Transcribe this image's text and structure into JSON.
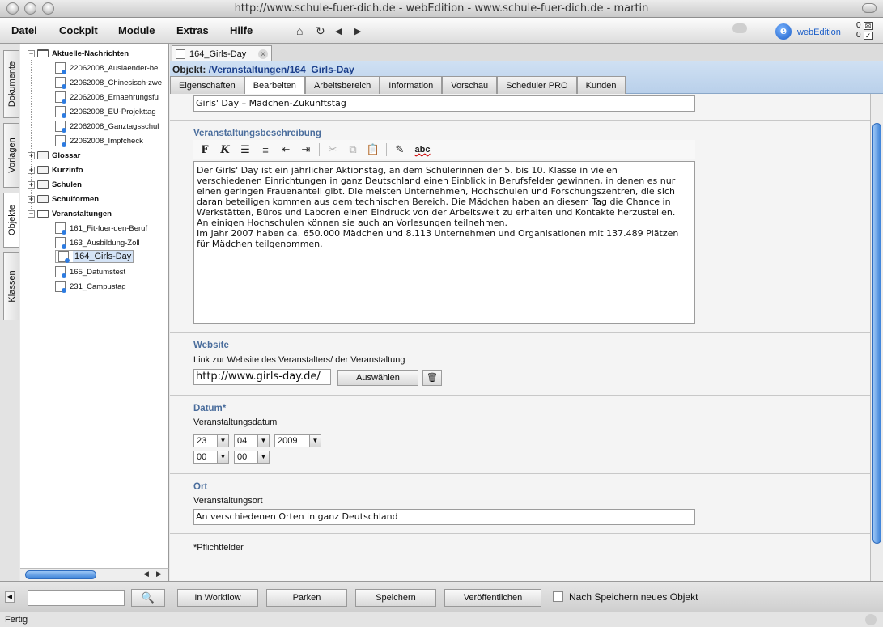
{
  "window": {
    "title": "http://www.schule-fuer-dich.de - webEdition - www.schule-fuer-dich.de - martin"
  },
  "menu": {
    "items": [
      "Datei",
      "Cockpit",
      "Module",
      "Extras",
      "Hilfe"
    ],
    "brand": "webEdition",
    "brand_letter": "e",
    "counter1": "0",
    "counter2": "0"
  },
  "side_tabs": [
    "Dokumente",
    "Vorlagen",
    "Objekte",
    "Klassen"
  ],
  "tree": {
    "aktuelle": {
      "label": "Aktuelle-Nachrichten",
      "children": [
        "22062008_Auslaender-be",
        "22062008_Chinesisch-zwe",
        "22062008_Ernaehrungsfu",
        "22062008_EU-Projekttag",
        "22062008_Ganztagsschul",
        "22062008_Impfcheck"
      ]
    },
    "folders": [
      "Glossar",
      "Kurzinfo",
      "Schulen",
      "Schulformen"
    ],
    "veranstaltungen": {
      "label": "Veranstaltungen",
      "children": [
        "161_Fit-fuer-den-Beruf",
        "163_Ausbildung-Zoll",
        "164_Girls-Day",
        "165_Datumstest",
        "231_Campustag"
      ]
    }
  },
  "doc_tab": {
    "label": "164_Girls-Day"
  },
  "object": {
    "prefix": "Objekt:",
    "path": "/Veranstaltungen/164_Girls-Day"
  },
  "tabs": [
    "Eigenschaften",
    "Bearbeiten",
    "Arbeitsbereich",
    "Information",
    "Vorschau",
    "Scheduler PRO",
    "Kunden"
  ],
  "form": {
    "name_value": "Girls' Day – Mädchen-Zukunftstag",
    "beschreibung_heading": "Veranstaltungsbeschreibung",
    "beschreibung_text": "Der Girls' Day ist ein jährlicher Aktionstag, an dem Schülerinnen der 5. bis 10. Klasse in vielen\nverschiedenen Einrichtungen in ganz Deutschland einen Einblick in Berufsfelder gewinnen, in denen es nur\neinen geringen Frauenanteil gibt. Die meisten Unternehmen, Hochschulen und Forschungszentren, die sich\ndaran beteiligen kommen aus dem technischen Bereich. Die Mädchen haben an diesem Tag die Chance in\nWerkstätten, Büros und Laboren einen Eindruck von der Arbeitswelt zu erhalten und Kontakte herzustellen.\nAn einigen Hochschulen können sie auch an Vorlesungen teilnehmen.\nIm Jahr 2007 haben ca. 650.000 Mädchen und 8.113 Unternehmen und Organisationen mit 137.489 Plätzen\nfür Mädchen teilgenommen.",
    "toolbar": {
      "bold": "F",
      "italic": "K",
      "spell": "abc"
    },
    "website_heading": "Website",
    "website_sub": "Link zur Website des Veranstalters/ der Veranstaltung",
    "website_value": "http://www.girls-day.de/",
    "website_button": "Auswählen",
    "datum_heading": "Datum*",
    "datum_sub": "Veranstaltungsdatum",
    "day": "23",
    "month": "04",
    "year": "2009",
    "hour": "00",
    "minute": "00",
    "ort_heading": "Ort",
    "ort_sub": "Veranstaltungsort",
    "ort_value": "An verschiedenen Orten in ganz Deutschland",
    "required_note": "*Pflichtfelder"
  },
  "bottom": {
    "buttons": [
      "In Workflow",
      "Parken",
      "Speichern",
      "Veröffentlichen"
    ],
    "checkbox_label": "Nach Speichern neues Objekt"
  },
  "status": "Fertig"
}
